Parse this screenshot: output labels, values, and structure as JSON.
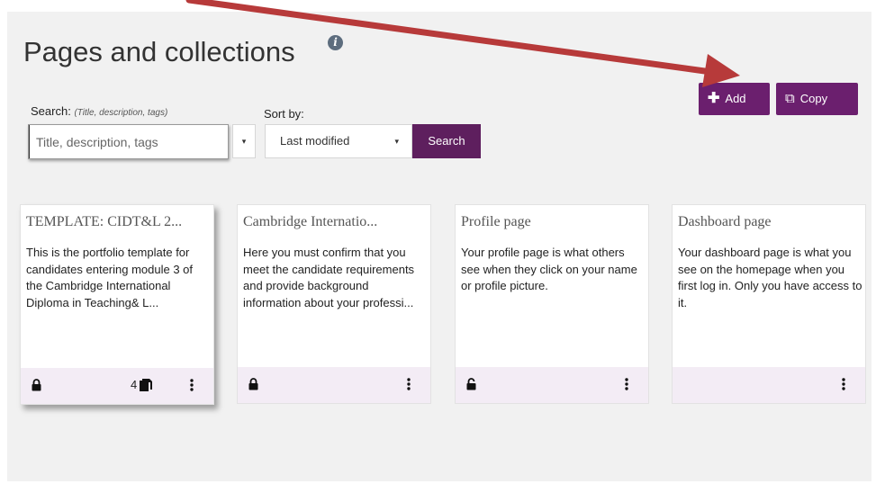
{
  "header": {
    "title": "Pages and collections",
    "info_icon": "info-icon"
  },
  "actions": {
    "add_label": "Add",
    "copy_label": "Copy",
    "add_icon": "plus-icon",
    "copy_icon": "copy-icon"
  },
  "search": {
    "label": "Search:",
    "hint": "(Title, description, tags)",
    "placeholder": "Title, description, tags",
    "value": "",
    "type_caret": "▾",
    "button_label": "Search"
  },
  "sort": {
    "label": "Sort by:",
    "selected": "Last modified"
  },
  "cards": [
    {
      "title": "TEMPLATE: CIDT&L 2...",
      "description": "This is the portfolio template for candidates entering module 3 of the Cambridge International Diploma in Teaching& L...",
      "locked": true,
      "page_count": "4"
    },
    {
      "title": "Cambridge Internatio...",
      "description": "Here you must confirm that you meet the candidate requirements and provide background information about your professi...",
      "locked": true
    },
    {
      "title": "Profile page",
      "description": "Your profile page is what others see when they click on your name or profile picture.",
      "locked": false
    },
    {
      "title": "Dashboard page",
      "description": "Your dashboard page is what you see on the homepage when you first log in. Only you have access to it."
    }
  ],
  "colors": {
    "brand": "#6b1f6e",
    "annotation_arrow": "#b73a3a",
    "card_footer": "#f3ecf5"
  }
}
